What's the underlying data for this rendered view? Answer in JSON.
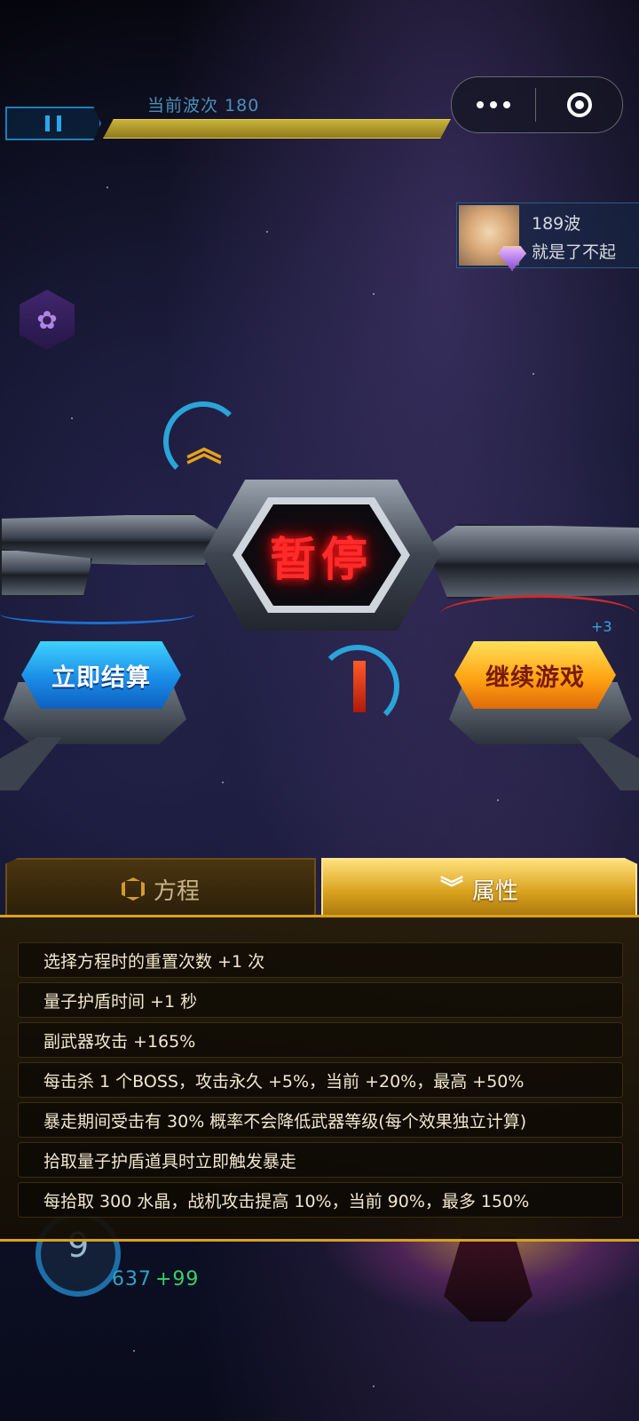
{
  "hud": {
    "wave_label": "当前波次 180"
  },
  "rank_card": {
    "wave": "189波",
    "message": "就是了不起"
  },
  "pause_title": "暂停",
  "buttons": {
    "settle": "立即结算",
    "continue": "继续游戏"
  },
  "tabs": [
    {
      "label": "方程",
      "icon": "hexagon-icon",
      "active": false
    },
    {
      "label": "属性",
      "icon": "double-chevron-down-icon",
      "active": true
    }
  ],
  "attributes": [
    "选择方程时的重置次数 +1 次",
    "量子护盾时间 +1 秒",
    "副武器攻击 +165%",
    "每击杀 1 个BOSS，攻击永久 +5%，当前 +20%，最高 +50%",
    "暴走期间受击有 30% 概率不会降低武器等级(每个效果独立计算)",
    "拾取量子护盾道具时立即触发暴走",
    "每拾取 300 水晶，战机攻击提高 10%，当前 90%，最多 150%"
  ],
  "bottom_hud": {
    "level": "9",
    "score": "637",
    "score_bonus": "+99"
  },
  "side_hud": {
    "shield_count": "+3"
  },
  "colors": {
    "accent_gold": "#d9a21e",
    "settle_blue": "#1a8de6",
    "continue_orange": "#ffa412",
    "pause_red": "#ff2a2a"
  }
}
